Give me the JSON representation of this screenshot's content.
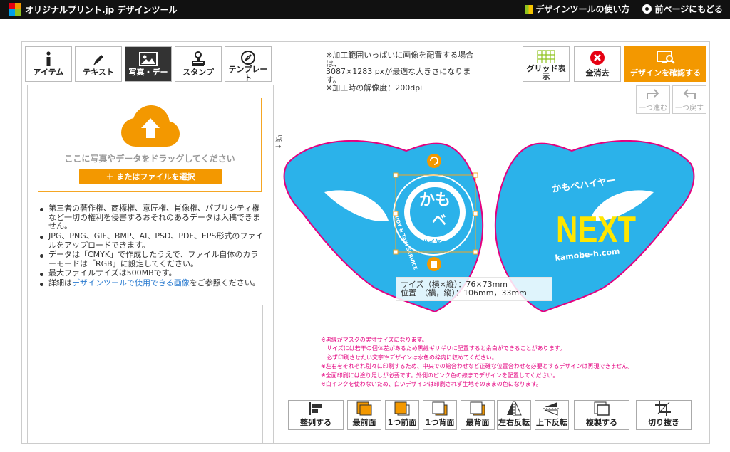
{
  "header": {
    "logo_text": "オリジナルプリント.jp デザインツール",
    "links": [
      "デザインツールの使い方",
      "前ページにもどる"
    ]
  },
  "tabs": [
    {
      "label": "アイテム",
      "icon": "info-icon"
    },
    {
      "label": "テキスト",
      "icon": "pen-icon"
    },
    {
      "label": "写真・デー",
      "icon": "image-icon",
      "active": true
    },
    {
      "label": "スタンプ",
      "icon": "stamp-icon"
    },
    {
      "label": "テンプレー ト",
      "icon": "compass-icon"
    }
  ],
  "upload": {
    "drop_text": "ここに写真やデータをドラッグしてください",
    "file_button": "＋ またはファイルを選択"
  },
  "notes": [
    "第三者の著作権、商標権、意匠権、肖像権、パブリシティ権など一切の権利を侵害するおそれのあるデータは入稿できません。",
    "JPG、PNG、GIF、BMP、AI、PSD、PDF、EPS形式のファイルをアップロードできます。",
    "データは「CMYK」で作成したうえで、ファイル自体のカラーモードは「RGB」に設定してください。",
    "最大ファイルサイズは500MBです。"
  ],
  "notes_link": {
    "before": "詳細は",
    "link": "デザインツールで使用できる画像",
    "after": "をご参照ください。"
  },
  "info": {
    "line1": "※加工範囲いっぱいに画像を配置する場合は、",
    "line2": "3087×1283 pxが最適な大きさになります。",
    "line3": "※加工時の解像度：200dpi"
  },
  "buttons": {
    "grid": "グリッド表示",
    "clear": "全消去",
    "confirm": "デザインを確認する",
    "redo": "一つ進む",
    "undo": "一つ戻す"
  },
  "origin": "点\n→",
  "mask": {
    "left_logo_top": "かも",
    "left_logo_mid": "ベ",
    "left_logo_arc": "ハイヤー",
    "left_ring_text": "ENJOY & TAXI SERVICE",
    "right_brand": "かもべハイヤー",
    "right_big": "NEXT",
    "right_url": "kamobe-h.com",
    "colors": {
      "mask": "#2bb2ea",
      "outline": "#e4007f",
      "yellow": "#ffe600"
    }
  },
  "tooltip": {
    "size": "サイズ（横×縦）：76×73mm",
    "pos": "位置　（横，縦）：106mm，33mm"
  },
  "warnings": [
    "※黒線がマスクの実寸サイズになります。",
    "　サイズには若干の個体差があるため黒線ギリギリに配置すると余白ができることがあります。",
    "　必ず印刷させたい文字やデザインは水色の枠内に収めてください。",
    "※左右をそれぞれ別々に印刷するため、中央での絵合わせなど正確な位置合わせを必要とするデザインは再現できません。",
    "※全面印刷には塗り足しが必要です。外側のピンク色の線までデザインを配置してください。",
    "※白インクを使わないため、白いデザインは印刷されず生地そのままの色になります。"
  ],
  "toolbar": [
    "整列する",
    "最前面",
    "1つ前面",
    "1つ背面",
    "最背面",
    "左右反転",
    "上下反転",
    "複製する",
    "切り抜き"
  ],
  "accent": "#f39800"
}
